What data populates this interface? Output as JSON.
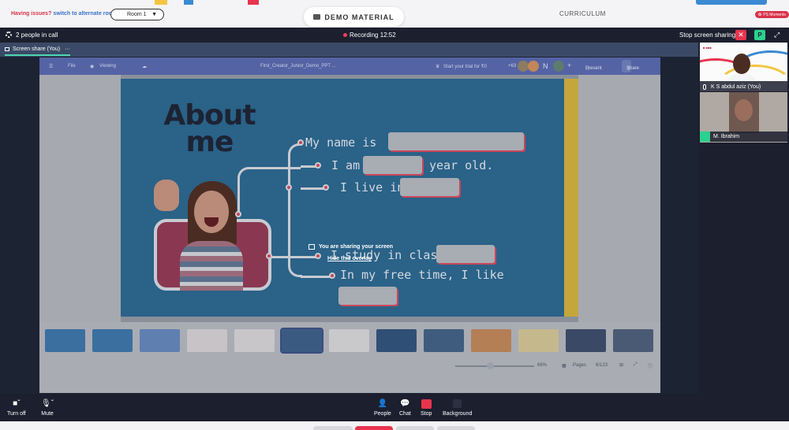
{
  "topbar": {
    "issues_text": "Having issues?",
    "switch_text": "switch to alternate room",
    "room": "Room 1",
    "demo_material": "DEMO MATERIAL",
    "curriculum": "CURRICULUM",
    "moments": "PS Moments"
  },
  "call": {
    "people_count": "2 people in call",
    "recording": "Recording 12:52",
    "stop_sharing": "Stop screen sharing",
    "p_badge": "P",
    "tab_label": "Screen share (You)"
  },
  "slides_app": {
    "file": "File",
    "viewing": "Viewing",
    "doc_title": "First_Creator_Junior_Demo_PPT ...",
    "trial": "Start your trial for ₹0",
    "present": "Present",
    "share": "Share",
    "avatar_letter": "N",
    "extra_count": "+63",
    "zoom": "66%",
    "pages_label": "Pages",
    "page_num": "6/123"
  },
  "slide": {
    "about_me": "About me",
    "my_name": "My name is",
    "i_am": "I am",
    "year_old": "year old.",
    "i_live": "I live in",
    "study": "I study in class",
    "free_time": "In my free time, I like"
  },
  "overlay": {
    "sharing": "You are sharing your screen",
    "hide": "Hide this overlay"
  },
  "participants": [
    {
      "name": "K S abdul aziz (You)"
    },
    {
      "name": "M. Ibrahim"
    }
  ],
  "controls": {
    "turn_off": "Turn off",
    "mute": "Mute",
    "people": "People",
    "chat": "Chat",
    "stop": "Stop",
    "background": "Background"
  },
  "colors": {
    "accent_red": "#e8344e",
    "accent_green": "#2bd18f",
    "call_bg": "#1c1f2e",
    "slide_bg": "#2a6288"
  }
}
